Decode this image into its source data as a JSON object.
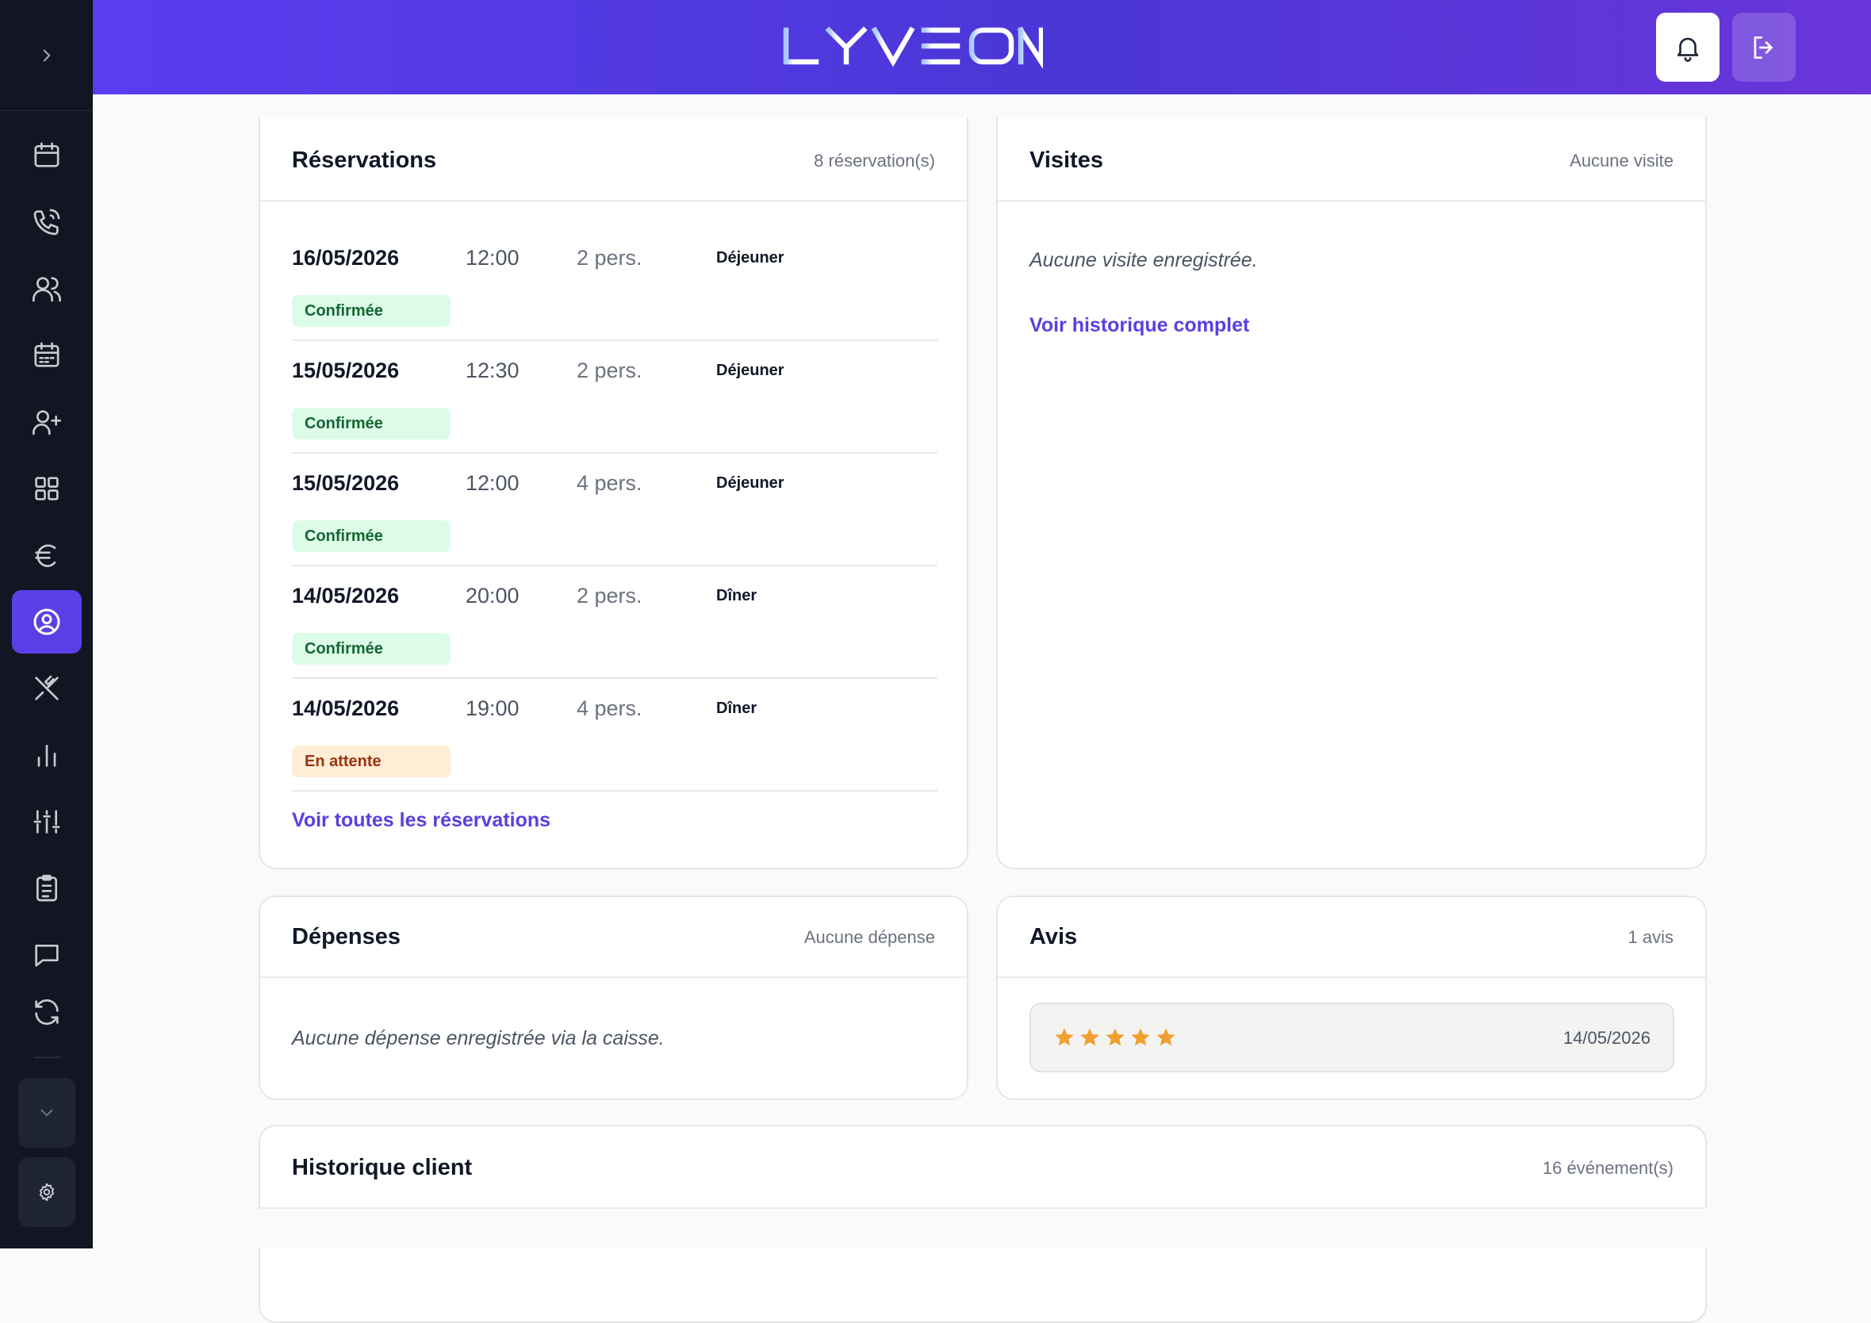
{
  "brand": {
    "logo": "LYVEON",
    "accent": "#5b3fe6",
    "sidebar_bg": "#111622"
  },
  "sidebar": {
    "items": [
      {
        "name": "calendar-icon"
      },
      {
        "name": "phone-icon"
      },
      {
        "name": "users-icon"
      },
      {
        "name": "calendar-list-icon"
      },
      {
        "name": "user-plus-icon"
      },
      {
        "name": "grid-icon"
      },
      {
        "name": "euro-icon"
      },
      {
        "name": "user-circle-icon",
        "active": true
      },
      {
        "name": "utensils-crossed-icon"
      },
      {
        "name": "bar-chart-icon"
      },
      {
        "name": "sliders-icon"
      },
      {
        "name": "clipboard-icon"
      },
      {
        "name": "message-icon"
      },
      {
        "name": "refresh-icon"
      }
    ]
  },
  "reservations": {
    "title": "Réservations",
    "count": "8 réservation(s)",
    "rows": [
      {
        "date": "16/05/2026",
        "time": "12:00",
        "pers": "2 pers.",
        "meal": "Déjeuner",
        "status": "Confirmée"
      },
      {
        "date": "15/05/2026",
        "time": "12:30",
        "pers": "2 pers.",
        "meal": "Déjeuner",
        "status": "Confirmée"
      },
      {
        "date": "15/05/2026",
        "time": "12:00",
        "pers": "4 pers.",
        "meal": "Déjeuner",
        "status": "Confirmée"
      },
      {
        "date": "14/05/2026",
        "time": "20:00",
        "pers": "2 pers.",
        "meal": "Dîner",
        "status": "Confirmée"
      },
      {
        "date": "14/05/2026",
        "time": "19:00",
        "pers": "4 pers.",
        "meal": "Dîner",
        "status": "En attente"
      }
    ],
    "link": "Voir toutes les réservations"
  },
  "visits": {
    "title": "Visites",
    "count": "Aucune visite",
    "empty": "Aucune visite enregistrée.",
    "link": "Voir historique complet"
  },
  "expenses": {
    "title": "Dépenses",
    "count": "Aucune dépense",
    "empty": "Aucune dépense enregistrée via la caisse."
  },
  "reviews": {
    "title": "Avis",
    "count": "1 avis",
    "items": [
      {
        "rating": 5,
        "date": "14/05/2026"
      }
    ],
    "star_color": "#f0a030"
  },
  "history": {
    "title": "Historique client",
    "count": "16 événement(s)"
  }
}
